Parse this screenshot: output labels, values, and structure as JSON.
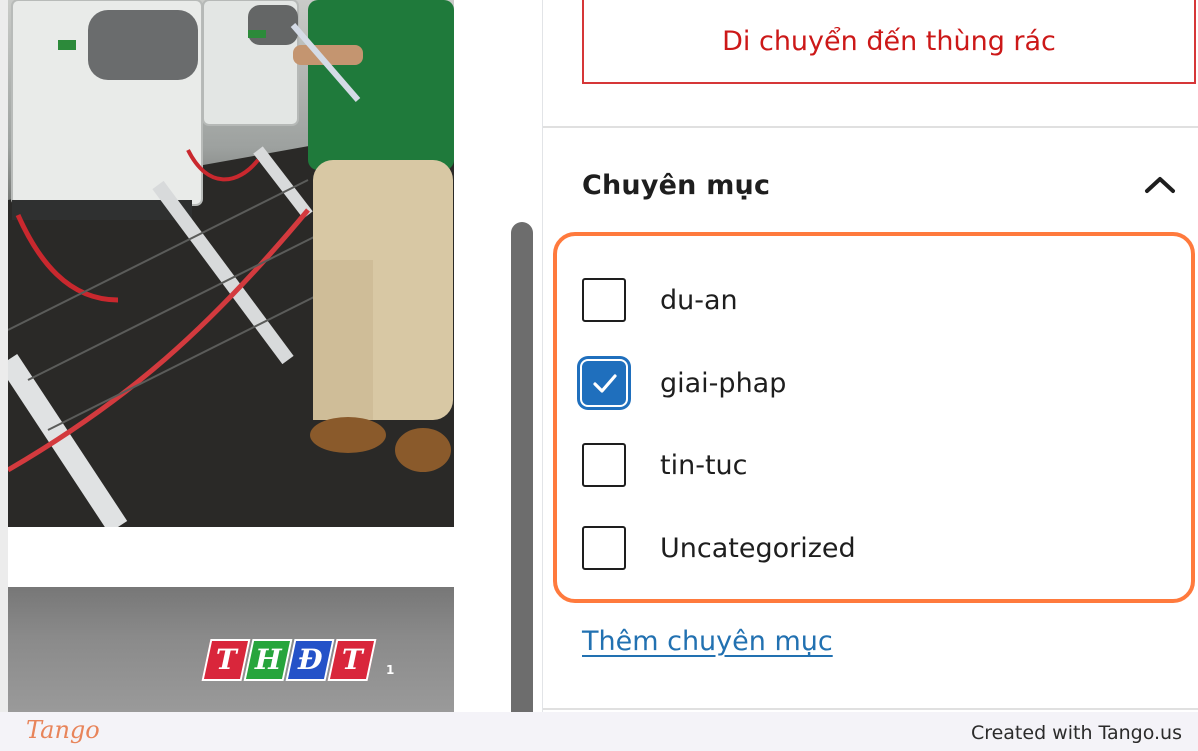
{
  "sidebar": {
    "trash_button": "Di chuyển đến thùng rác",
    "categories_panel": {
      "title": "Chuyên mục",
      "collapse_icon": "chevron-up-icon",
      "items": [
        {
          "label": "du-an",
          "checked": false
        },
        {
          "label": "giai-phap",
          "checked": true
        },
        {
          "label": "tin-tuc",
          "checked": false
        },
        {
          "label": "Uncategorized",
          "checked": false
        }
      ],
      "add_link": "Thêm chuyên mục"
    }
  },
  "media": {
    "tv_logo_letters": [
      "T",
      "H",
      "Đ",
      "T"
    ],
    "tv_logo_suffix": "1"
  },
  "footer": {
    "logo": "Tango",
    "credit": "Created with Tango.us"
  },
  "colors": {
    "highlight_outline": "#ff7a3d",
    "danger": "#cc1818",
    "link": "#2271b1",
    "checkbox_checked": "#1f6fbd",
    "tv_logo": [
      "#d9263b",
      "#27a53c",
      "#2452c8",
      "#d9263b"
    ]
  }
}
